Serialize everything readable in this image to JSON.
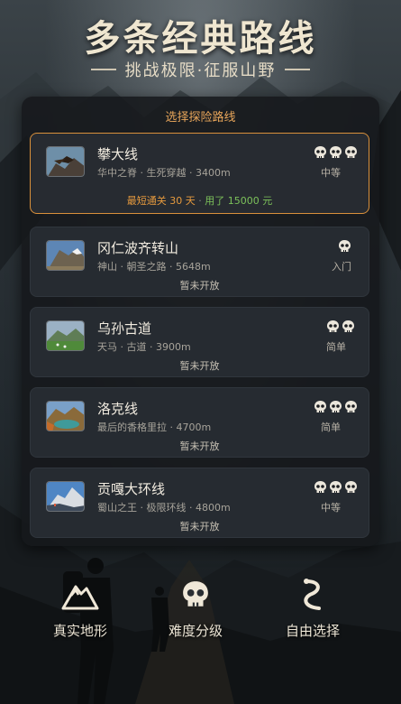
{
  "header": {
    "title": "多条经典路线",
    "subtitle": "挑战极限·征服山野"
  },
  "panel": {
    "title": "选择探险路线",
    "routes": [
      {
        "name": "攀大线",
        "desc": "华中之脊 · 生死穿越 · 3400m",
        "difficulty": "中等",
        "skulls": 3,
        "record_days": "最短通关 30 天",
        "record_sep": "·",
        "record_cost": "用了 15000 元",
        "thumb": "eagle-mountain"
      },
      {
        "name": "冈仁波齐转山",
        "desc": "神山 · 朝圣之路 · 5648m",
        "difficulty": "入门",
        "skulls": 1,
        "status": "暂未开放",
        "thumb": "snow-peak"
      },
      {
        "name": "乌孙古道",
        "desc": "天马 · 古道 · 3900m",
        "difficulty": "简单",
        "skulls": 2,
        "status": "暂未开放",
        "thumb": "green-valley"
      },
      {
        "name": "洛克线",
        "desc": "最后的香格里拉 · 4700m",
        "difficulty": "简单",
        "skulls": 3,
        "status": "暂未开放",
        "thumb": "lake-autumn"
      },
      {
        "name": "贡嘎大环线",
        "desc": "蜀山之王 · 极限环线 · 4800m",
        "difficulty": "中等",
        "skulls": 3,
        "status": "暂未开放",
        "thumb": "gongga-peak"
      }
    ]
  },
  "features": [
    {
      "label": "真实地形",
      "icon": "mountain-icon"
    },
    {
      "label": "难度分级",
      "icon": "skull-icon"
    },
    {
      "label": "自由选择",
      "icon": "route-icon"
    }
  ],
  "colors": {
    "accent": "#e69a3e",
    "success": "#7cc15a",
    "panel": "#16181b"
  }
}
